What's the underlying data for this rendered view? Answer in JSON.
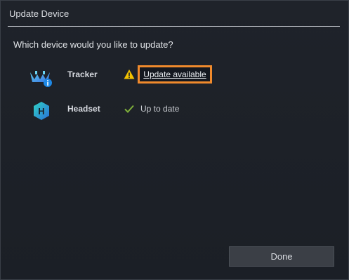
{
  "dialog": {
    "title": "Update Device",
    "question": "Which device would you like to update?"
  },
  "devices": [
    {
      "name": "Tracker",
      "icon": "tracker-icon",
      "status_icon": "warning-icon",
      "status": "Update available",
      "status_color": "#f2c200"
    },
    {
      "name": "Headset",
      "icon": "headset-icon",
      "icon_letter": "H",
      "status_icon": "checkmark-icon",
      "status": "Up to date",
      "status_color": "#7fb03a"
    }
  ],
  "footer": {
    "done_label": "Done"
  },
  "colors": {
    "accent_highlight": "#f08a2c",
    "background": "#1b1f26"
  }
}
